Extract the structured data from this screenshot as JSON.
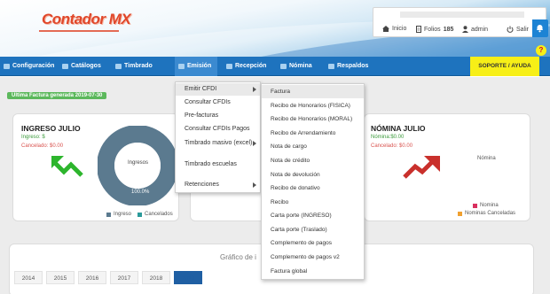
{
  "brand": {
    "logo_text": "Contador MX",
    "logo_color": "#e0472a"
  },
  "userbox": {
    "inicio": "Inicio",
    "folios_label": "Folios",
    "folios_count": "185",
    "user": "admin",
    "salir": "Salir"
  },
  "nav": {
    "items": [
      {
        "label": "Configuración"
      },
      {
        "label": "Catálogos"
      },
      {
        "label": "Timbrado TXT"
      },
      {
        "label": "Emisión"
      },
      {
        "label": "Recepción"
      },
      {
        "label": "Nómina"
      },
      {
        "label": "Respaldos"
      }
    ],
    "support": "SOPORTE / AYUDA",
    "support_icon": "?"
  },
  "badge": "Ultima Factura generada 2019-07-30",
  "ingreso": {
    "title": "INGRESO JULIO",
    "ingreso_line": "Ingreso: $",
    "cancelado_line": "Cancelado: $0.00",
    "donut_label": "Ingresos",
    "donut_pct": "100.0%",
    "legend": [
      "Ingreso",
      "Cancelados"
    ]
  },
  "nomina": {
    "title": "NÓMINA JULIO",
    "nomina_line": "Nómina:$0.00",
    "cancelado_line": "Cancelado: $0.00",
    "chart_label": "Nómina",
    "legend": [
      "Nomina",
      "Nominas Canceladas"
    ]
  },
  "chart_section": {
    "title": "Gráfico de i",
    "years": [
      "2014",
      "2015",
      "2016",
      "2017",
      "2018",
      "2019"
    ]
  },
  "emision_menu": [
    {
      "label": "Emitir CFDI",
      "sub": true
    },
    {
      "label": "Consultar CFDIs",
      "sub": false
    },
    {
      "label": "Pre-facturas",
      "sub": false
    },
    {
      "label": "Consultar CFDIs Pagos",
      "sub": false
    },
    {
      "label": "Timbrado masivo (excel)",
      "sub": true
    },
    {
      "label": "Timbrado escuelas",
      "sub": false
    },
    {
      "label": "Retenciones",
      "sub": true
    }
  ],
  "emitir_submenu": [
    "Factura",
    "Recibo de Honorarios (FISICA)",
    "Recibo de Honorarios (MORAL)",
    "Recibo de Arrendamiento",
    "Nota de cargo",
    "Nota de crédito",
    "Nota de devolución",
    "Recibo de donativo",
    "Recibo",
    "Carta porte (INGRESO)",
    "Carta porte (Traslado)",
    "Complemento de pagos",
    "Complemento de pagos v2",
    "Factura global"
  ],
  "colors": {
    "nav_blue": "#1e73be",
    "support_yellow": "#f7ef17",
    "donut_slate": "#5b7a8f",
    "green_arrow": "#2db52d",
    "red_arrow": "#c9302c",
    "active_year": "#1f5fa3"
  }
}
